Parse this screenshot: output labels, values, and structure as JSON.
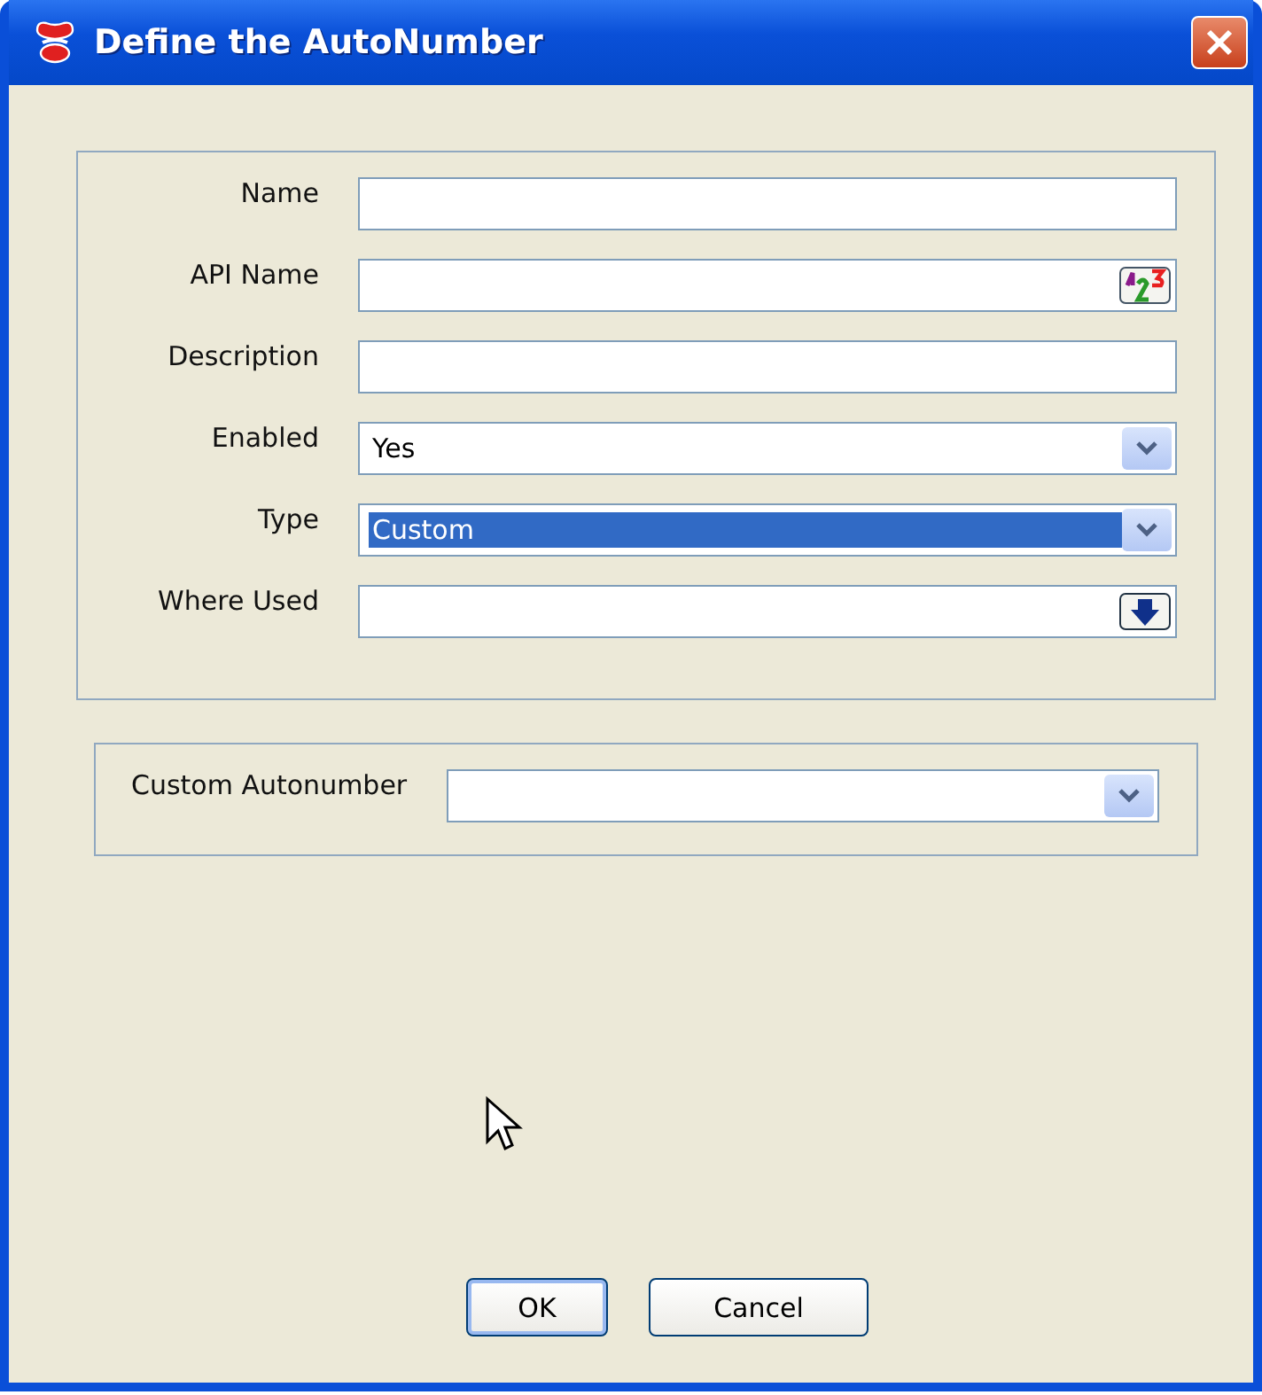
{
  "window": {
    "title": "Define the AutoNumber"
  },
  "fields": [
    {
      "label": "Name",
      "kind": "text"
    },
    {
      "label": "API Name",
      "kind": "numbering"
    },
    {
      "label": "Description",
      "kind": "text"
    },
    {
      "label": "Enabled",
      "kind": "dropdown",
      "value": "Yes",
      "focused": false
    },
    {
      "label": "Type",
      "kind": "dropdown",
      "value": "Custom",
      "focused": true
    },
    {
      "label": "Where Used",
      "kind": "lookup"
    }
  ],
  "custom": {
    "label": "Custom Autonumber",
    "kind": "dropdown"
  },
  "buttons": [
    {
      "label": "OK",
      "default": true
    },
    {
      "label": "Cancel",
      "default": false
    }
  ]
}
